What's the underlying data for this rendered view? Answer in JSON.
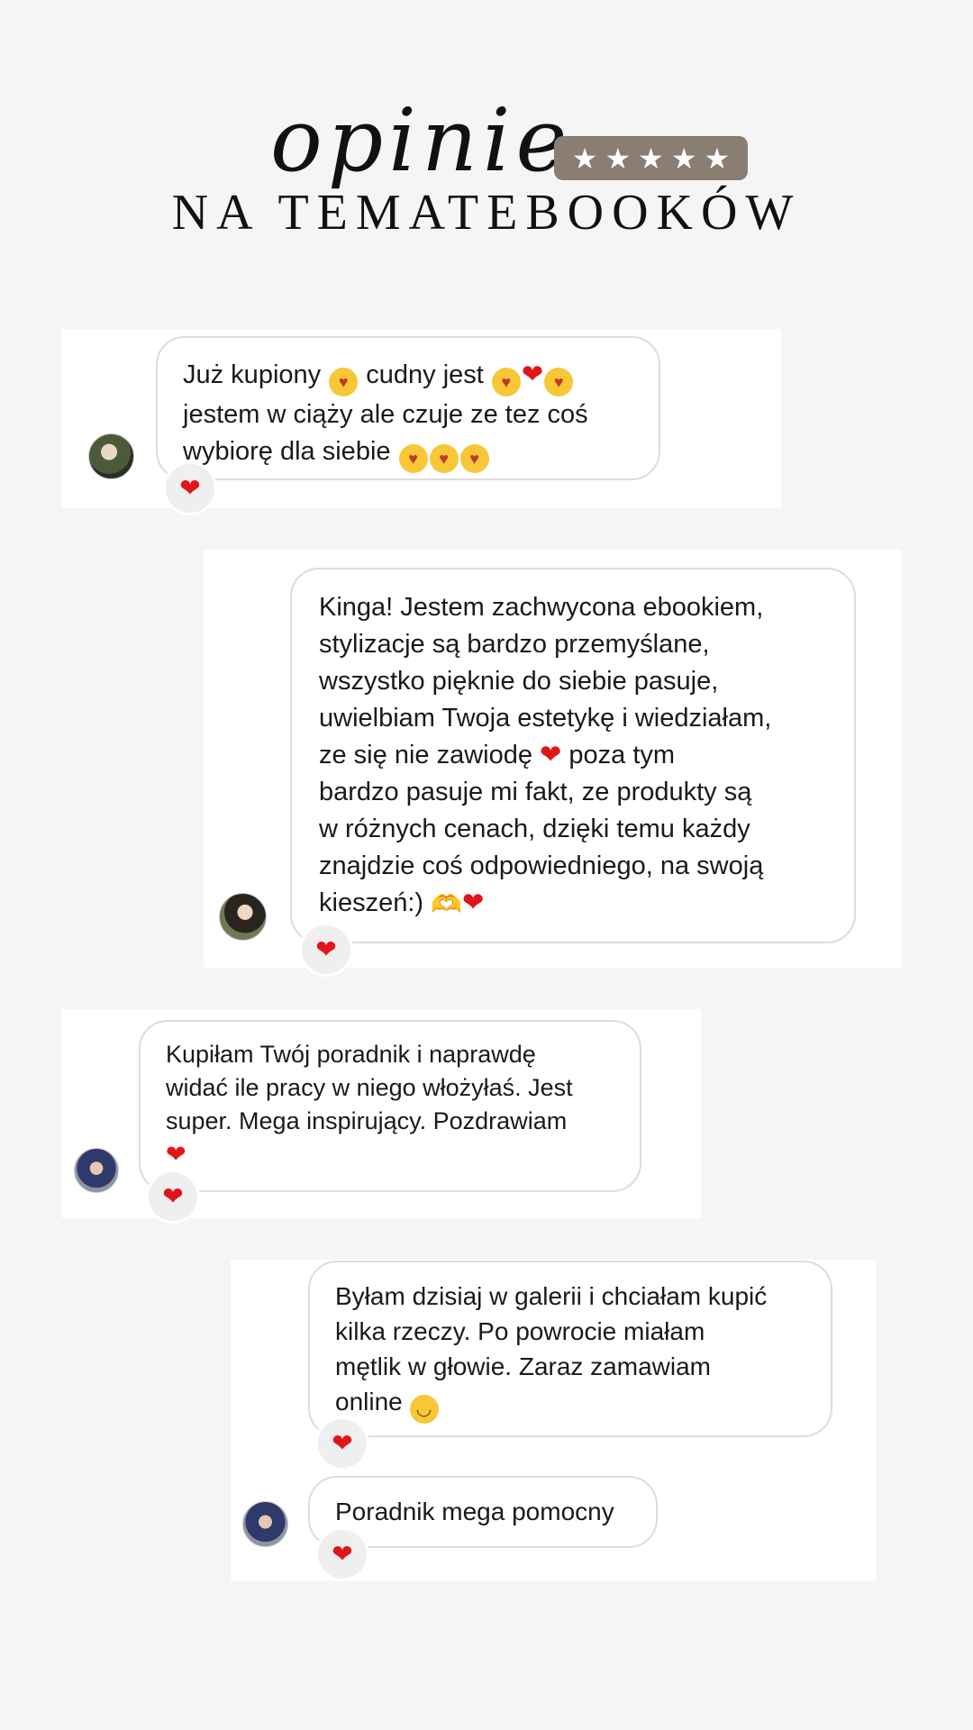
{
  "header": {
    "script_title": "opinie",
    "subtitle": "NA TEMATEBOOKÓW",
    "rating_stars": 5
  },
  "reviews": [
    {
      "lines": [
        "Już kupiony 😍 cudny jest 😍❤️😍",
        "jestem w ciąży ale czuje ze tez coś",
        "wybiorę dla siebie 😍😍😍"
      ],
      "reaction": "❤️"
    },
    {
      "lines": [
        "Kinga! Jestem zachwycona ebookiem,",
        "stylizacje są bardzo przemyślane,",
        "wszystko pięknie do siebie pasuje,",
        "uwielbiam Twoja estetykę i wiedziałam,",
        "ze się nie zawiodę ❤️ poza tym",
        "bardzo pasuje mi fakt, ze produkty są",
        "w różnych cenach, dzięki temu każdy",
        "znajdzie coś odpowiedniego, na swoją",
        "kieszeń:) 🫶❤️"
      ],
      "reaction": "❤️"
    },
    {
      "lines": [
        "Kupiłam Twój poradnik i naprawdę",
        "widać ile pracy w niego włożyłaś. Jest",
        "super. Mega inspirujący. Pozdrawiam",
        "❤️"
      ],
      "reaction": "❤️"
    },
    {
      "lines": [
        "Byłam dzisiaj w galerii i chciałam kupić",
        "kilka rzeczy. Po powrocie miałam",
        "mętlik w głowie. Zaraz zamawiam",
        "online 🙂"
      ],
      "reaction": "❤️"
    },
    {
      "lines": [
        "Poradnik mega pomocny"
      ],
      "reaction": "❤️"
    }
  ],
  "colors": {
    "background": "#f5f5f5",
    "star_badge": "#8a7d72",
    "heart": "#e0151b"
  }
}
